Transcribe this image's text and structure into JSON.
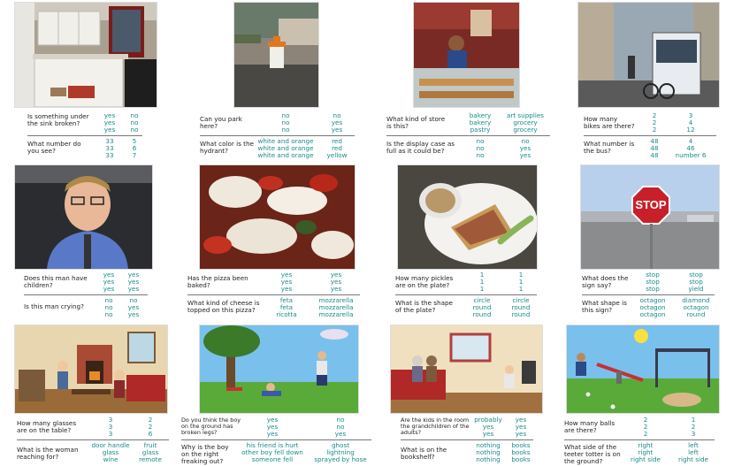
{
  "colors": {
    "answer": "#1a8a8a",
    "question": "#222222",
    "rule": "#777777"
  },
  "cells": [
    {
      "image": "kitchen-photo",
      "qa": [
        {
          "question": "Is something under the sink broken?",
          "col1": [
            "yes",
            "yes",
            "yes"
          ],
          "col2": [
            "no",
            "no",
            "no"
          ]
        },
        {
          "question": "What number do you see?",
          "col1": [
            "33",
            "33",
            "33"
          ],
          "col2": [
            "5",
            "6",
            "7"
          ]
        }
      ]
    },
    {
      "image": "hydrant-photo",
      "qa": [
        {
          "question": "Can you park here?",
          "col1": [
            "no",
            "no",
            "no"
          ],
          "col2": [
            "no",
            "yes",
            "yes"
          ]
        },
        {
          "question": "What color is the hydrant?",
          "col1": [
            "white and orange",
            "white and orange",
            "white and orange"
          ],
          "col2": [
            "red",
            "red",
            "yellow"
          ]
        }
      ]
    },
    {
      "image": "bakery-photo",
      "qa": [
        {
          "question": "What kind of store is this?",
          "col1": [
            "bakery",
            "bakery",
            "pastry"
          ],
          "col2": [
            "art supplies",
            "grocery",
            "grocery"
          ]
        },
        {
          "question": "Is the display case as full as it could be?",
          "col1": [
            "no",
            "no",
            "no"
          ],
          "col2": [
            "no",
            "yes",
            "yes"
          ]
        }
      ]
    },
    {
      "image": "bus-photo",
      "qa": [
        {
          "question": "How many bikes are there?",
          "col1": [
            "2",
            "2",
            "2"
          ],
          "col2": [
            "3",
            "4",
            "12"
          ]
        },
        {
          "question": "What number is the bus?",
          "col1": [
            "48",
            "48",
            "48"
          ],
          "col2": [
            "4",
            "46",
            "number 6"
          ]
        }
      ]
    },
    {
      "image": "man-photo",
      "qa": [
        {
          "question": "Does this man have children?",
          "col1": [
            "yes",
            "yes",
            "yes"
          ],
          "col2": [
            "yes",
            "yes",
            "yes"
          ]
        },
        {
          "question": "Is this man crying?",
          "col1": [
            "no",
            "no",
            "no"
          ],
          "col2": [
            "no",
            "yes",
            "yes"
          ]
        }
      ]
    },
    {
      "image": "pizza-photo",
      "qa": [
        {
          "question": "Has the pizza been baked?",
          "col1": [
            "yes",
            "yes",
            "yes"
          ],
          "col2": [
            "yes",
            "yes",
            "yes"
          ]
        },
        {
          "question": "What kind of cheese is topped on this pizza?",
          "col1": [
            "feta",
            "feta",
            "ricotta"
          ],
          "col2": [
            "mozzarella",
            "mozzarella",
            "mozzarella"
          ]
        }
      ]
    },
    {
      "image": "sandwich-photo",
      "qa": [
        {
          "question": "How many pickles are on the plate?",
          "col1": [
            "1",
            "1",
            "1"
          ],
          "col2": [
            "1",
            "1",
            "1"
          ]
        },
        {
          "question": "What is the shape of the plate?",
          "col1": [
            "circle",
            "round",
            "round"
          ],
          "col2": [
            "circle",
            "round",
            "round"
          ]
        }
      ]
    },
    {
      "image": "stop-sign-photo",
      "qa": [
        {
          "question": "What does the sign say?",
          "col1": [
            "stop",
            "stop",
            "stop"
          ],
          "col2": [
            "stop",
            "stop",
            "yield"
          ]
        },
        {
          "question": "What shape is this sign?",
          "col1": [
            "octagon",
            "octagon",
            "octagon"
          ],
          "col2": [
            "diamond",
            "octagon",
            "round"
          ]
        }
      ]
    },
    {
      "image": "living-room-scene",
      "qa": [
        {
          "question": "How many glasses are on the table?",
          "col1": [
            "3",
            "3",
            "3"
          ],
          "col2": [
            "2",
            "2",
            "6"
          ]
        },
        {
          "question": "What is the woman reaching for?",
          "col1": [
            "door handle",
            "glass",
            "wine"
          ],
          "col2": [
            "fruit",
            "glass",
            "remote"
          ]
        }
      ]
    },
    {
      "image": "park-tree-scene",
      "qa": [
        {
          "question": "Do you think the boy on the ground has broken legs?",
          "col1": [
            "yes",
            "yes",
            "yes"
          ],
          "col2": [
            "no",
            "no",
            "yes"
          ]
        },
        {
          "question": "Why is the boy on the right freaking out?",
          "col1": [
            "his friend is hurt",
            "other boy fell down",
            "someone fell"
          ],
          "col2": [
            "ghost",
            "lightning",
            "sprayed by hose"
          ]
        }
      ]
    },
    {
      "image": "grandparents-scene",
      "qa": [
        {
          "question": "Are the kids in the room the grandchildren of the adults?",
          "col1": [
            "probably",
            "yes",
            "yes"
          ],
          "col2": [
            "yes",
            "yes",
            "yes"
          ]
        },
        {
          "question": "What is on the bookshelf?",
          "col1": [
            "nothing",
            "nothing",
            "nothing"
          ],
          "col2": [
            "books",
            "books",
            "books"
          ]
        }
      ]
    },
    {
      "image": "playground-scene",
      "qa": [
        {
          "question": "How many balls are there?",
          "col1": [
            "2",
            "2",
            "2"
          ],
          "col2": [
            "1",
            "2",
            "3"
          ]
        },
        {
          "question": "What side of the teeter totter is on the ground?",
          "col1": [
            "right",
            "right",
            "right side"
          ],
          "col2": [
            "left",
            "left",
            "right side"
          ]
        }
      ]
    }
  ]
}
